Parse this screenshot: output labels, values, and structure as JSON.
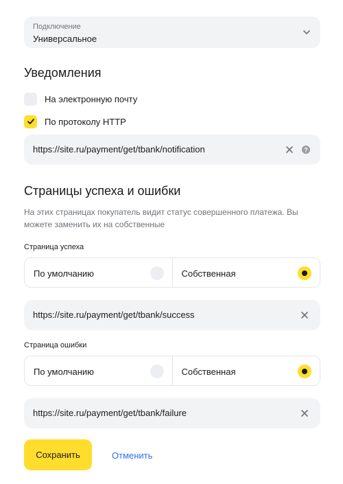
{
  "connection": {
    "label": "Подключение",
    "value": "Универсальное"
  },
  "notifications": {
    "title": "Уведомления",
    "email_label": "На электронную почту",
    "email_checked": false,
    "http_label": "По протоколу HTTP",
    "http_checked": true,
    "url": "https://site.ru/payment/get/tbank/notification"
  },
  "pages": {
    "title": "Страницы успеха и ошибки",
    "description": "На этих страницах покупатель видит статус совершенного платежа. Вы можете заменить их на собственные",
    "success": {
      "label": "Страница успеха",
      "option_default": "По умолчанию",
      "option_custom": "Собственная",
      "selected": "custom",
      "url": "https://site.ru/payment/get/tbank/success"
    },
    "failure": {
      "label": "Страница ошибки",
      "option_default": "По умолчанию",
      "option_custom": "Собственная",
      "selected": "custom",
      "url": "https://site.ru/payment/get/tbank/failure"
    }
  },
  "actions": {
    "save_label": "Сохранить",
    "cancel_label": "Отменить"
  },
  "colors": {
    "accent": "#ffdd2d",
    "link": "#336fee",
    "field_bg": "#f2f3f5"
  },
  "icons": [
    "chevron-down-icon",
    "check-icon",
    "close-icon",
    "help-icon"
  ]
}
